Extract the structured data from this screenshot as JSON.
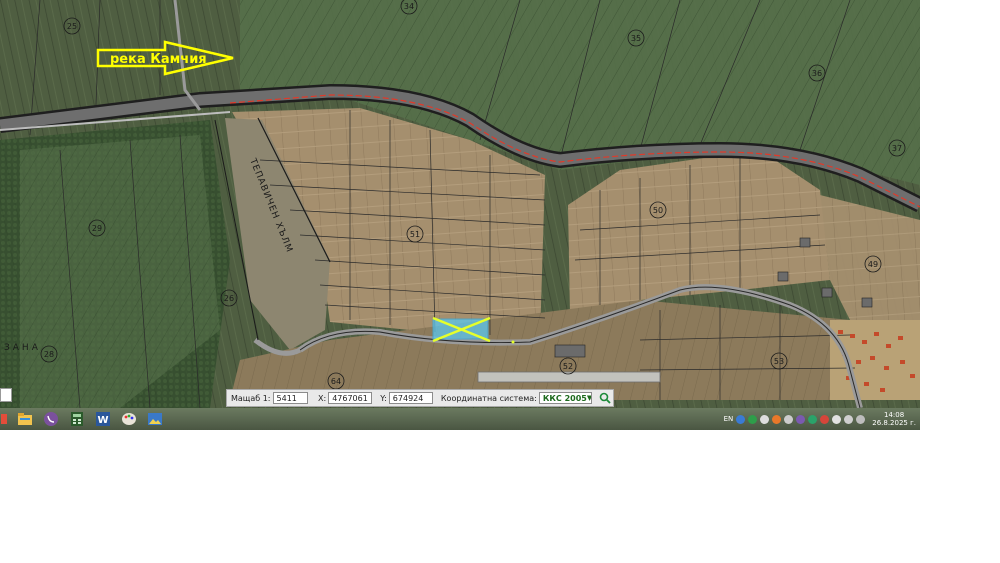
{
  "map": {
    "river_label": "река Камчия",
    "hill_label": "ТЕПАВИЧЕН ХЪЛМ",
    "village_label": "ЗАНА",
    "plot_numbers": [
      "25",
      "34",
      "35",
      "36",
      "37",
      "29",
      "26",
      "28",
      "64",
      "51",
      "50",
      "49",
      "52",
      "53"
    ],
    "colors": {
      "arrow_yellow": "#ffff00",
      "marker_cyan": "#5bc8f0",
      "marker_cross": "#e6ff2a",
      "road_red": "#e03a2a"
    }
  },
  "toolbar": {
    "scale_label": "Мащаб 1:",
    "scale_value": "5411",
    "x_label": "X:",
    "x_value": "4767061",
    "y_label": "Y:",
    "y_value": "674924",
    "crs_label": "Координатна система:",
    "crs_value": "ККС 2005",
    "zoom_icon": "magnifier-icon"
  },
  "taskbar": {
    "apps": [
      "file-explorer-icon",
      "viber-icon",
      "calculator-icon",
      "word-icon",
      "paint-icon",
      "photos-icon"
    ],
    "language": "EN",
    "time": "14:08",
    "date": "26.8.2025 г."
  }
}
